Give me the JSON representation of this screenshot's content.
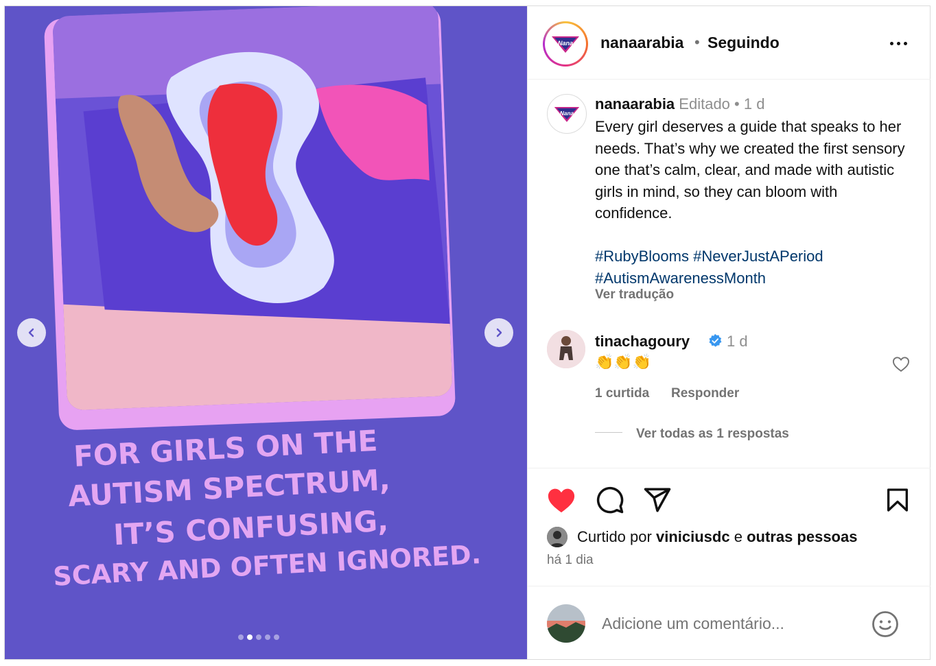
{
  "media": {
    "headline_lines": [
      "For girls on the",
      "autism spectrum,",
      "it’s confusing,",
      "scary and often ignored."
    ],
    "carousel_total": 5,
    "carousel_active": 2,
    "bg_color": "#5f54c8",
    "text_color": "#e3a6f2",
    "prev_icon": "chevron-left-icon",
    "next_icon": "chevron-right-icon"
  },
  "header": {
    "username": "nanaarabia",
    "separator": "•",
    "follow_status": "Seguindo",
    "logo_text": "Nana"
  },
  "caption": {
    "username": "nanaarabia",
    "edited": "Editado",
    "dot": "•",
    "time": "1 d",
    "text": "Every girl deserves a guide that speaks to her needs. That’s why we created the first sensory one that’s calm, clear, and made with autistic girls in mind, so they can bloom with confidence.",
    "hashtags": [
      "#RubyBlooms",
      "#NeverJustAPeriod",
      "#AutismAwarenessMonth"
    ],
    "translate": "Ver tradução"
  },
  "comment": {
    "username": "tinachagoury",
    "time": "1 d",
    "text": "👏👏👏",
    "likes": "1 curtida",
    "reply": "Responder",
    "view_replies": "Ver todas as 1 respostas"
  },
  "footer": {
    "liked_prefix": "Curtido por",
    "liked_user": "viniciusdc",
    "liked_and": "e",
    "liked_others": "outras pessoas",
    "posted": "há 1 dia",
    "comment_placeholder": "Adicione um comentário...",
    "like_color": "#ff3040"
  }
}
